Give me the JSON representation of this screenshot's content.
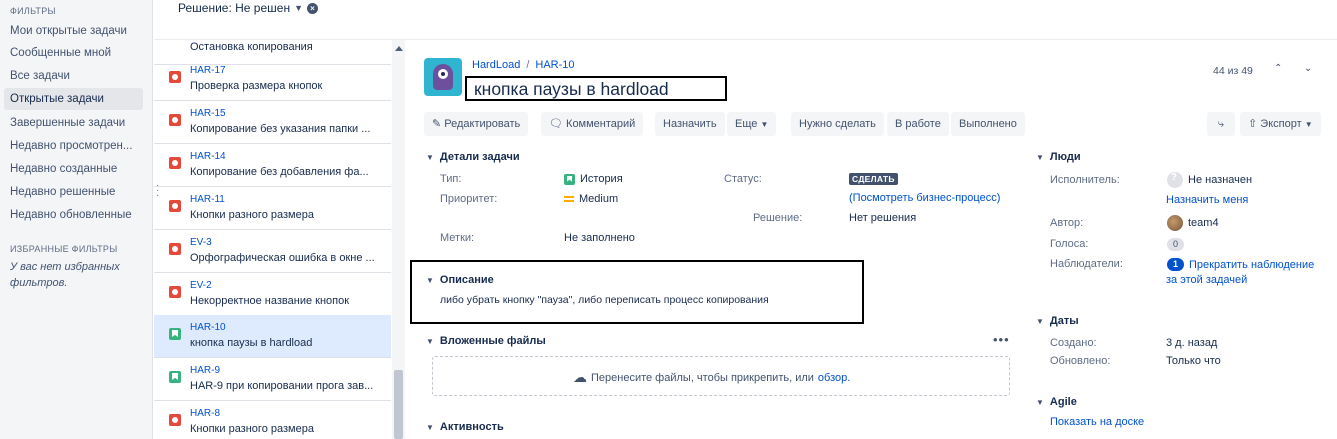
{
  "sidebar": {
    "filters_heading": "ФИЛЬТРЫ",
    "items": [
      {
        "label": "Мои открытые задачи",
        "active": false
      },
      {
        "label": "Сообщенные мной",
        "active": false
      },
      {
        "label": "Все задачи",
        "active": false
      },
      {
        "label": "Открытые задачи",
        "active": true
      },
      {
        "label": "Завершенные задачи",
        "active": false
      },
      {
        "label": "Недавно просмотрен...",
        "active": false
      },
      {
        "label": "Недавно созданные",
        "active": false
      },
      {
        "label": "Недавно решенные",
        "active": false
      },
      {
        "label": "Недавно обновленные",
        "active": false
      }
    ],
    "favorites_heading": "ИЗБРАННЫЕ ФИЛЬТРЫ",
    "favorites_empty": "У вас нет избранных фильтров."
  },
  "topbar": {
    "resolution_filter": "Решение: Не решен"
  },
  "issue_list": {
    "partial_first": "Остановка копирования",
    "items": [
      {
        "key": "HAR-17",
        "summary": "Проверка размера кнопок",
        "type": "bug",
        "selected": false
      },
      {
        "key": "HAR-15",
        "summary": "Копирование без указания папки ...",
        "type": "bug",
        "selected": false
      },
      {
        "key": "HAR-14",
        "summary": "Копирование без добавления фа...",
        "type": "bug",
        "selected": false
      },
      {
        "key": "HAR-11",
        "summary": "Кнопки разного размера",
        "type": "bug",
        "selected": false
      },
      {
        "key": "EV-3",
        "summary": "Орфографическая ошибка в окне ...",
        "type": "bug",
        "selected": false
      },
      {
        "key": "EV-2",
        "summary": "Некорректное название кнопок",
        "type": "bug",
        "selected": false
      },
      {
        "key": "HAR-10",
        "summary": "кнопка паузы в hardload",
        "type": "story",
        "selected": true
      },
      {
        "key": "HAR-9",
        "summary": "HAR-9 при копировании прога зав...",
        "type": "story",
        "selected": false
      },
      {
        "key": "HAR-8",
        "summary": "Кнопки разного размера",
        "type": "bug",
        "selected": false
      }
    ]
  },
  "issue": {
    "project": "HardLoad",
    "key": "HAR-10",
    "title": "кнопка паузы в hardload",
    "pager": "44 из 49",
    "toolbar": {
      "edit": "Редактировать",
      "comment": "Комментарий",
      "assign": "Назначить",
      "more": "Еще",
      "todo": "Нужно сделать",
      "in_progress": "В работе",
      "done": "Выполнено",
      "export": "Экспорт"
    },
    "details": {
      "heading": "Детали задачи",
      "type_label": "Тип:",
      "type_value": "История",
      "priority_label": "Приоритет:",
      "priority_value": "Medium",
      "labels_label": "Метки:",
      "labels_value": "Не заполнено",
      "status_label": "Статус:",
      "status_value": "СДЕЛАТЬ",
      "workflow_link": "(Посмотреть бизнес-процесс)",
      "resolution_label": "Решение:",
      "resolution_value": "Нет решения"
    },
    "description": {
      "heading": "Описание",
      "text": "либо убрать кнопку \"пауза\", либо переписать процесс копирования"
    },
    "attachments": {
      "heading": "Вложенные файлы",
      "drop_text": "Перенесите файлы, чтобы прикрепить, или",
      "browse_link": "обзор."
    },
    "activity": {
      "heading": "Активность"
    },
    "people": {
      "heading": "Люди",
      "assignee_label": "Исполнитель:",
      "assignee_value": "Не назначен",
      "assign_me": "Назначить меня",
      "reporter_label": "Автор:",
      "reporter_value": "team4",
      "votes_label": "Голоса:",
      "votes_value": "0",
      "watchers_label": "Наблюдатели:",
      "watchers_count": "1",
      "stop_watching_1": "Прекратить наблюдение",
      "stop_watching_2": "за этой задачей"
    },
    "dates": {
      "heading": "Даты",
      "created_label": "Создано:",
      "created_value": "3 д. назад",
      "updated_label": "Обновлено:",
      "updated_value": "Только что"
    },
    "agile": {
      "heading": "Agile",
      "board_link": "Показать на доске"
    }
  },
  "colors": {
    "link": "#0052cc",
    "bug": "#e5493a",
    "story": "#36b37e",
    "selected_row": "#deebff"
  }
}
